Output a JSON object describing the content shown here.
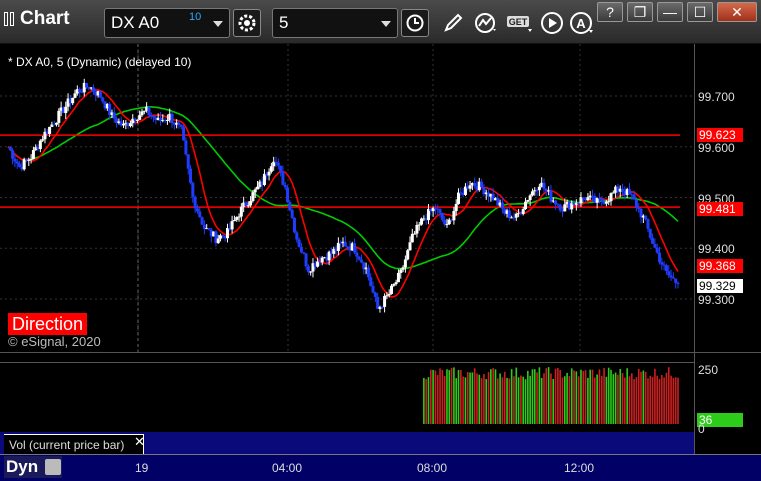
{
  "window": {
    "title": "Chart",
    "buttons": {
      "help": "?",
      "restore": "❐",
      "minimize": "—",
      "maximize": "☐",
      "close": "✕"
    }
  },
  "toolbar": {
    "symbol": "DX A0",
    "delay_badge": "10",
    "interval": "5",
    "icons": [
      "gear-icon",
      "clock-icon",
      "pencil-icon",
      "study-icon",
      "get-icon",
      "play-icon",
      "alert-icon"
    ]
  },
  "chart": {
    "info": "* DX A0, 5 (Dynamic) (delayed 10)",
    "watermark": "© eSignal, 2020",
    "direction_label": "Direction",
    "price_axis": [
      "99.700",
      "99.600",
      "99.500",
      "99.400",
      "99.300"
    ],
    "price_labels": [
      {
        "text": "99.623",
        "color": "#ff0000"
      },
      {
        "text": "99.481",
        "color": "#ff0000"
      },
      {
        "text": "99.368",
        "color": "#ff0000"
      },
      {
        "text": "99.329",
        "color": "#ffffff"
      }
    ],
    "colors": {
      "up": "#ffffff",
      "down": "#1f3cff",
      "ma_fast": "#ff0000",
      "ma_slow": "#00cc00",
      "resistance": "#ff0000"
    }
  },
  "volume": {
    "label": "Vol (current price bar)",
    "close_glyph": "✕",
    "axis": [
      "250",
      "0"
    ],
    "current": "36"
  },
  "bottom": {
    "mode": "Dyn",
    "time_labels": [
      "19",
      "04:00",
      "08:00",
      "12:00"
    ]
  },
  "chart_data": {
    "type": "candlestick",
    "symbol": "DX A0",
    "interval": "5",
    "ylim": [
      99.22,
      99.82
    ],
    "y_ticks": [
      99.7,
      99.6,
      99.5,
      99.4,
      99.3
    ],
    "horizontal_lines": [
      99.623,
      99.481
    ],
    "last_price": 99.329,
    "price_series": [
      99.6,
      99.56,
      99.58,
      99.62,
      99.65,
      99.68,
      99.71,
      99.72,
      99.7,
      99.66,
      99.64,
      99.66,
      99.67,
      99.65,
      99.66,
      99.63,
      99.5,
      99.44,
      99.42,
      99.43,
      99.47,
      99.5,
      99.53,
      99.58,
      99.52,
      99.42,
      99.36,
      99.38,
      99.39,
      99.41,
      99.4,
      99.36,
      99.28,
      99.31,
      99.35,
      99.42,
      99.46,
      99.48,
      99.44,
      99.5,
      99.53,
      99.52,
      99.5,
      99.47,
      99.46,
      99.5,
      99.53,
      99.5,
      99.48,
      99.49,
      99.5,
      99.49,
      99.5,
      99.52,
      99.5,
      99.46,
      99.4,
      99.35,
      99.33
    ],
    "volume_axis": [
      250,
      0
    ],
    "volume_current": 36,
    "time_labels": [
      "19",
      "04:00",
      "08:00",
      "12:00"
    ]
  }
}
